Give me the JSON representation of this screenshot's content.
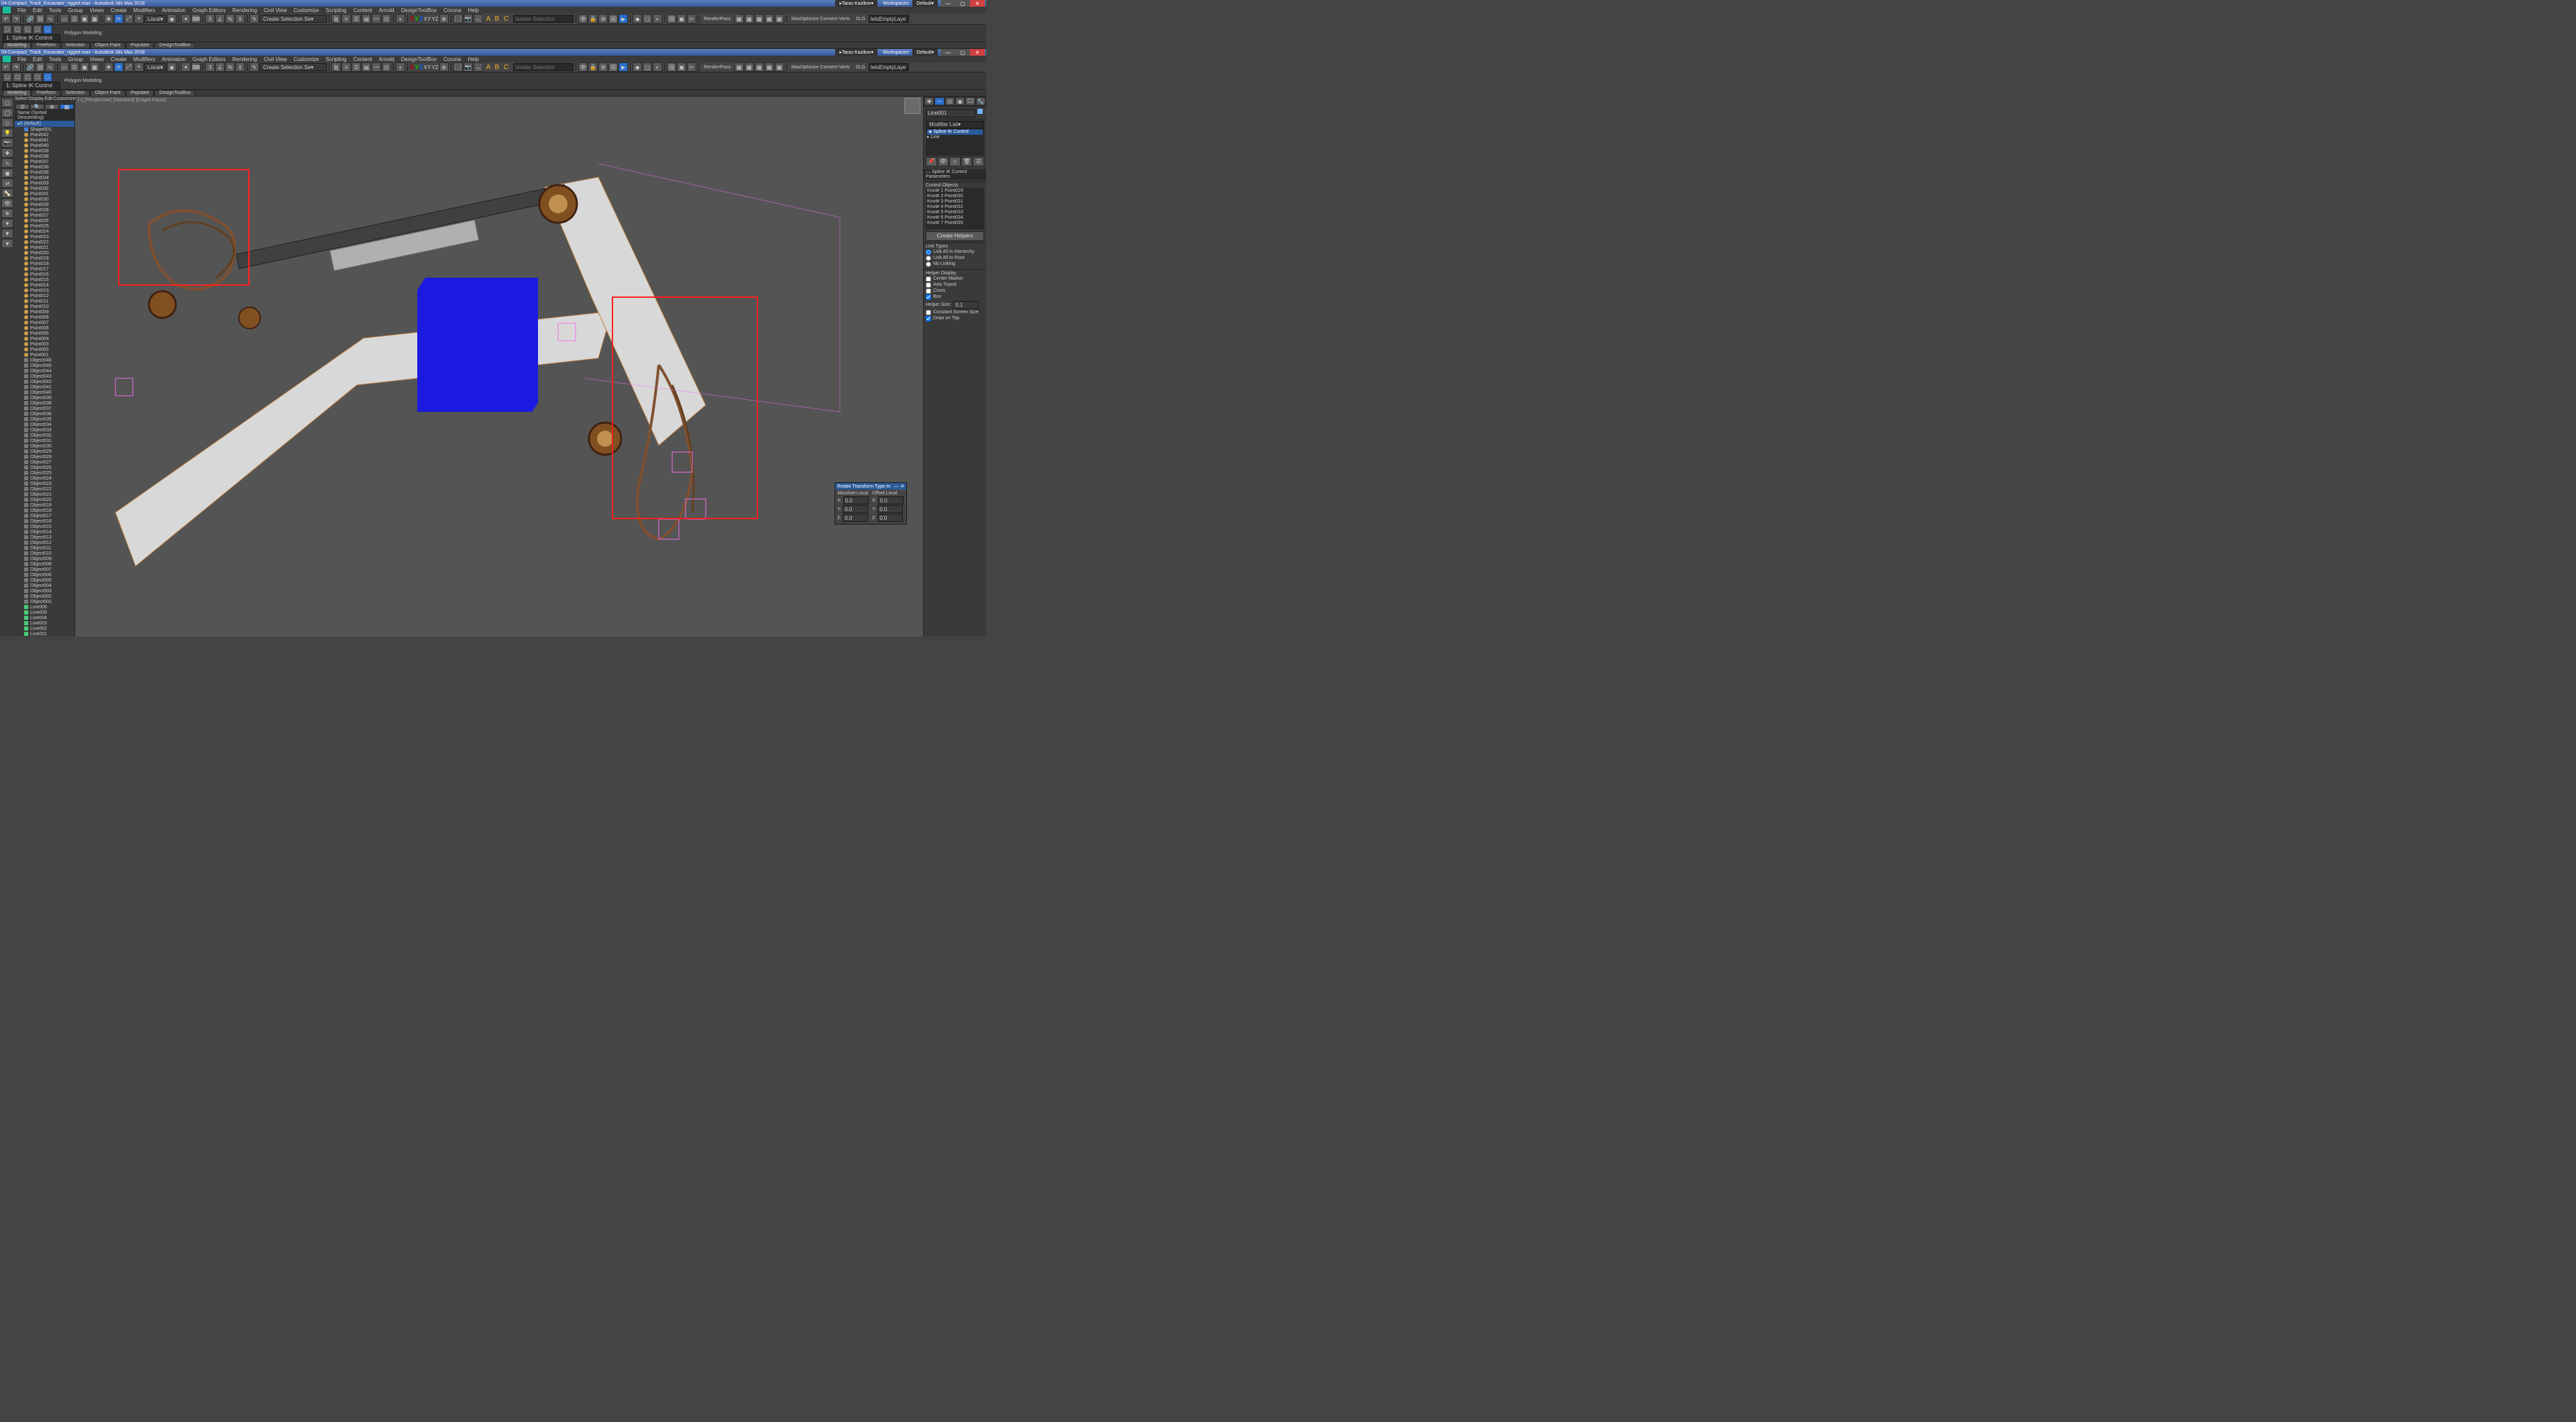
{
  "app": {
    "title": "04-Compact_Track_Excavator_rigged.max - Autodesk 3ds Max 2018",
    "user": "Taras Kazikov",
    "workspaces_label": "Workspaces:",
    "workspace": "Default"
  },
  "menus": [
    "File",
    "Edit",
    "Tools",
    "Group",
    "Views",
    "Create",
    "Modifiers",
    "Animation",
    "Graph Editors",
    "Rendering",
    "Civil View",
    "Customize",
    "Scripting",
    "Content",
    "Arnold",
    "DesignToolBox",
    "Corona",
    "Help"
  ],
  "toolbar": {
    "selection_set_dd": "Create Selection Se",
    "ref_coord": "Local",
    "named_sel": "",
    "search": "",
    "search_placeholder": "Isolate Selection",
    "abc": "A B C",
    "render_preset": "RenderIPass",
    "maxscript_hint": "MaxOptimize Connect-Verts",
    "slg_label": "SLG",
    "script_field": "letsEmptyLaye"
  },
  "ribbon": {
    "tabs": [
      "Modeling",
      "Freeform",
      "Selection",
      "Object Paint",
      "Populate",
      "DesignToolBox"
    ],
    "active_tab": "Modeling",
    "mode_label": "Polygon Modeling",
    "selected_object": "1: Spline IK Control"
  },
  "scene_explorer": {
    "header_tabs": [
      "Select",
      "Display",
      "Edit",
      "Customize"
    ],
    "sort_label": "Name (Sorted Descending)",
    "root": "0 (default)",
    "items": [
      {
        "t": "sh",
        "n": "Shape001"
      },
      {
        "t": "pt",
        "n": "Point042"
      },
      {
        "t": "pt",
        "n": "Point041"
      },
      {
        "t": "pt",
        "n": "Point040"
      },
      {
        "t": "pt",
        "n": "Point039"
      },
      {
        "t": "pt",
        "n": "Point038"
      },
      {
        "t": "pt",
        "n": "Point037"
      },
      {
        "t": "pt",
        "n": "Point036"
      },
      {
        "t": "pt",
        "n": "Point035"
      },
      {
        "t": "pt",
        "n": "Point034"
      },
      {
        "t": "pt",
        "n": "Point033"
      },
      {
        "t": "pt",
        "n": "Point032"
      },
      {
        "t": "pt",
        "n": "Point031"
      },
      {
        "t": "pt",
        "n": "Point030"
      },
      {
        "t": "pt",
        "n": "Point029"
      },
      {
        "t": "pt",
        "n": "Point028"
      },
      {
        "t": "pt",
        "n": "Point027"
      },
      {
        "t": "pt",
        "n": "Point026"
      },
      {
        "t": "pt",
        "n": "Point025"
      },
      {
        "t": "pt",
        "n": "Point024"
      },
      {
        "t": "pt",
        "n": "Point023"
      },
      {
        "t": "pt",
        "n": "Point022"
      },
      {
        "t": "pt",
        "n": "Point021"
      },
      {
        "t": "pt",
        "n": "Point020"
      },
      {
        "t": "pt",
        "n": "Point019"
      },
      {
        "t": "pt",
        "n": "Point018"
      },
      {
        "t": "pt",
        "n": "Point017"
      },
      {
        "t": "pt",
        "n": "Point016"
      },
      {
        "t": "pt",
        "n": "Point015"
      },
      {
        "t": "pt",
        "n": "Point014"
      },
      {
        "t": "pt",
        "n": "Point013"
      },
      {
        "t": "pt",
        "n": "Point012"
      },
      {
        "t": "pt",
        "n": "Point011"
      },
      {
        "t": "pt",
        "n": "Point010"
      },
      {
        "t": "pt",
        "n": "Point009"
      },
      {
        "t": "pt",
        "n": "Point008"
      },
      {
        "t": "pt",
        "n": "Point007"
      },
      {
        "t": "pt",
        "n": "Point006"
      },
      {
        "t": "pt",
        "n": "Point005"
      },
      {
        "t": "pt",
        "n": "Point004"
      },
      {
        "t": "pt",
        "n": "Point003"
      },
      {
        "t": "pt",
        "n": "Point002"
      },
      {
        "t": "pt",
        "n": "Point001"
      },
      {
        "t": "ob",
        "n": "Object046"
      },
      {
        "t": "ob",
        "n": "Object045"
      },
      {
        "t": "ob",
        "n": "Object044"
      },
      {
        "t": "ob",
        "n": "Object043"
      },
      {
        "t": "ob",
        "n": "Object042"
      },
      {
        "t": "ob",
        "n": "Object041"
      },
      {
        "t": "ob",
        "n": "Object040"
      },
      {
        "t": "ob",
        "n": "Object039"
      },
      {
        "t": "ob",
        "n": "Object038"
      },
      {
        "t": "ob",
        "n": "Object037"
      },
      {
        "t": "ob",
        "n": "Object036"
      },
      {
        "t": "ob",
        "n": "Object035"
      },
      {
        "t": "ob",
        "n": "Object034"
      },
      {
        "t": "ob",
        "n": "Object033"
      },
      {
        "t": "ob",
        "n": "Object032"
      },
      {
        "t": "ob",
        "n": "Object031"
      },
      {
        "t": "ob",
        "n": "Object030"
      },
      {
        "t": "ob",
        "n": "Object029"
      },
      {
        "t": "ob",
        "n": "Object028"
      },
      {
        "t": "ob",
        "n": "Object027"
      },
      {
        "t": "ob",
        "n": "Object026"
      },
      {
        "t": "ob",
        "n": "Object025"
      },
      {
        "t": "ob",
        "n": "Object024"
      },
      {
        "t": "ob",
        "n": "Object023"
      },
      {
        "t": "ob",
        "n": "Object022"
      },
      {
        "t": "ob",
        "n": "Object021"
      },
      {
        "t": "ob",
        "n": "Object020"
      },
      {
        "t": "ob",
        "n": "Object019"
      },
      {
        "t": "ob",
        "n": "Object018"
      },
      {
        "t": "ob",
        "n": "Object017"
      },
      {
        "t": "ob",
        "n": "Object016"
      },
      {
        "t": "ob",
        "n": "Object015"
      },
      {
        "t": "ob",
        "n": "Object014"
      },
      {
        "t": "ob",
        "n": "Object013"
      },
      {
        "t": "ob",
        "n": "Object012"
      },
      {
        "t": "ob",
        "n": "Object011"
      },
      {
        "t": "ob",
        "n": "Object010"
      },
      {
        "t": "ob",
        "n": "Object009"
      },
      {
        "t": "ob",
        "n": "Object008"
      },
      {
        "t": "ob",
        "n": "Object007"
      },
      {
        "t": "ob",
        "n": "Object006"
      },
      {
        "t": "ob",
        "n": "Object005"
      },
      {
        "t": "ob",
        "n": "Object004"
      },
      {
        "t": "ob",
        "n": "Object003"
      },
      {
        "t": "ob",
        "n": "Object002"
      },
      {
        "t": "ob",
        "n": "Object001"
      },
      {
        "t": "ln",
        "n": "Line006"
      },
      {
        "t": "ln",
        "n": "Line005"
      },
      {
        "t": "ln",
        "n": "Line004"
      },
      {
        "t": "ln",
        "n": "Line003"
      },
      {
        "t": "ln",
        "n": "Line002"
      },
      {
        "t": "ln",
        "n": "Line001"
      }
    ]
  },
  "viewport": {
    "label": "[+] [Perspective] [Standard] [Edged Faces]"
  },
  "command_panel": {
    "object_name": "Line001",
    "modifier_list_label": "Modifier List",
    "stack": [
      "Spline IK Control",
      "Line"
    ],
    "rollout_title": "Spline IK Control Parameters",
    "section_control": "Control Objects",
    "knots": [
      {
        "k": "Knot# 1",
        "p": "Point029"
      },
      {
        "k": "Knot# 2",
        "p": "Point030"
      },
      {
        "k": "Knot# 3",
        "p": "Point031"
      },
      {
        "k": "Knot# 4",
        "p": "Point032"
      },
      {
        "k": "Knot# 5",
        "p": "Point033"
      },
      {
        "k": "Knot# 6",
        "p": "Point034"
      },
      {
        "k": "Knot# 7",
        "p": "Point035"
      }
    ],
    "create_helpers_btn": "Create Helpers",
    "link_types_title": "Link Types",
    "link_opts": [
      "Link All in Hierarchy",
      "Link All to Root",
      "No Linking"
    ],
    "helper_display_title": "Helper Display",
    "helper_opts": [
      "Center Marker",
      "Axis Tripod",
      "Cross",
      "Box"
    ],
    "helper_size_label": "Helper Size:",
    "helper_size": "0.1",
    "constant_screen": "Constant Screen Size",
    "draw_on_top": "Draw on Top"
  },
  "transform_dialog": {
    "title": "Rotate Transform Type-In",
    "abs_label": "Absolute:Local",
    "off_label": "Offset:Local",
    "labels": [
      "X:",
      "Y:",
      "Z:"
    ],
    "abs": [
      "0.0",
      "0.0",
      "0.0"
    ],
    "off": [
      "0.0",
      "0.0",
      "0.0"
    ]
  }
}
